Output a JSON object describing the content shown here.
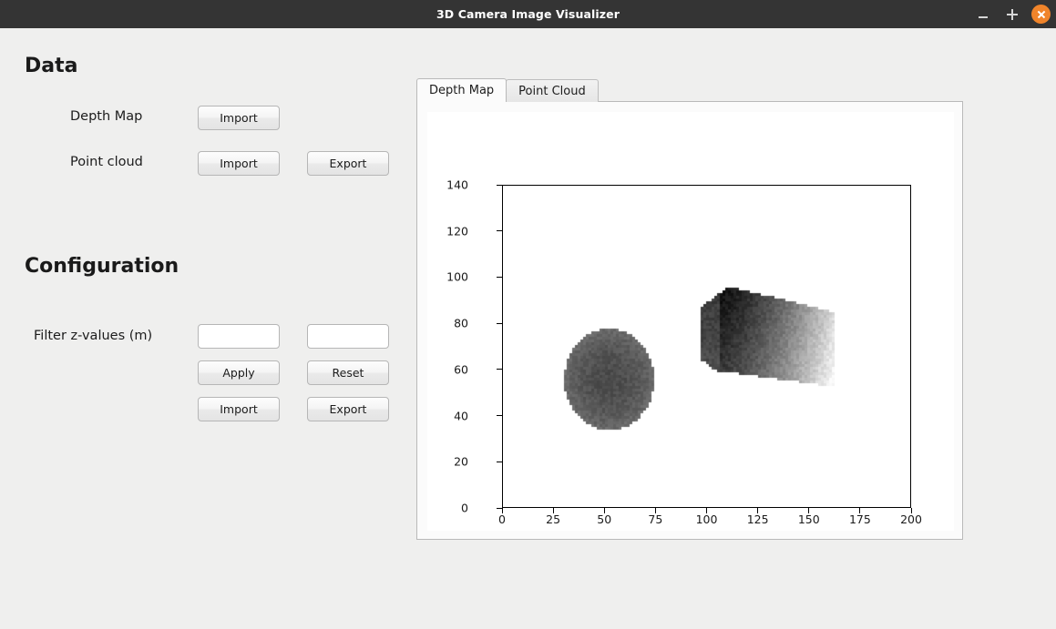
{
  "window": {
    "title": "3D Camera Image Visualizer",
    "controls": {
      "minimize": "minimize",
      "maximize": "maximize",
      "close": "close"
    },
    "close_color": "#f0842a",
    "titlebar_color": "#343434"
  },
  "panel": {
    "data_section": {
      "heading": "Data",
      "rows": [
        {
          "label": "Depth Map",
          "buttons": [
            "Import"
          ]
        },
        {
          "label": "Point cloud",
          "buttons": [
            "Import",
            "Export"
          ]
        }
      ],
      "depth_map_label": "Depth Map",
      "point_cloud_label": "Point cloud",
      "depth_import_label": "Import",
      "pc_import_label": "Import",
      "pc_export_label": "Export"
    },
    "config_section": {
      "heading": "Configuration",
      "filter_label": "Filter z-values (m)",
      "z_min_value": "",
      "z_max_value": "",
      "z_min_placeholder": "",
      "z_max_placeholder": "",
      "apply_label": "Apply",
      "reset_label": "Reset",
      "import_label": "Import",
      "export_label": "Export"
    }
  },
  "tabs": [
    {
      "label": "Depth Map",
      "active": true
    },
    {
      "label": "Point Cloud",
      "active": false
    }
  ],
  "tab_labels": {
    "depth_map": "Depth Map",
    "point_cloud": "Point Cloud"
  },
  "chart_data": {
    "type": "heatmap",
    "title": "",
    "xlabel": "",
    "ylabel": "",
    "xlim": [
      0,
      200
    ],
    "ylim": [
      0,
      140
    ],
    "y_inverted": true,
    "grid": false,
    "legend": null,
    "colormap": "gray",
    "background": "#ffffff",
    "xticks": [
      0,
      25,
      50,
      75,
      100,
      125,
      150,
      175,
      200
    ],
    "xtick_labels": [
      "0",
      "25",
      "50",
      "75",
      "100",
      "125",
      "150",
      "175",
      "200"
    ],
    "yticks": [
      0,
      20,
      40,
      60,
      80,
      100,
      120,
      140
    ],
    "ytick_labels": [
      "0",
      "20",
      "40",
      "60",
      "80",
      "100",
      "120",
      "140"
    ],
    "objects": [
      {
        "name": "sphere",
        "shape": "ellipse",
        "center_x": 52,
        "center_y": 56,
        "radius_x": 22,
        "radius_y": 22,
        "gray_center": 0.3,
        "gray_edge": 0.42,
        "noise": true
      },
      {
        "name": "box",
        "shape": "cuboid",
        "x_range": [
          97,
          163
        ],
        "y_range": [
          52,
          99
        ],
        "gray_dark": 0.1,
        "gray_light": 0.92,
        "gradient_direction": "left-dark-to-right-light",
        "noise": true
      }
    ]
  }
}
